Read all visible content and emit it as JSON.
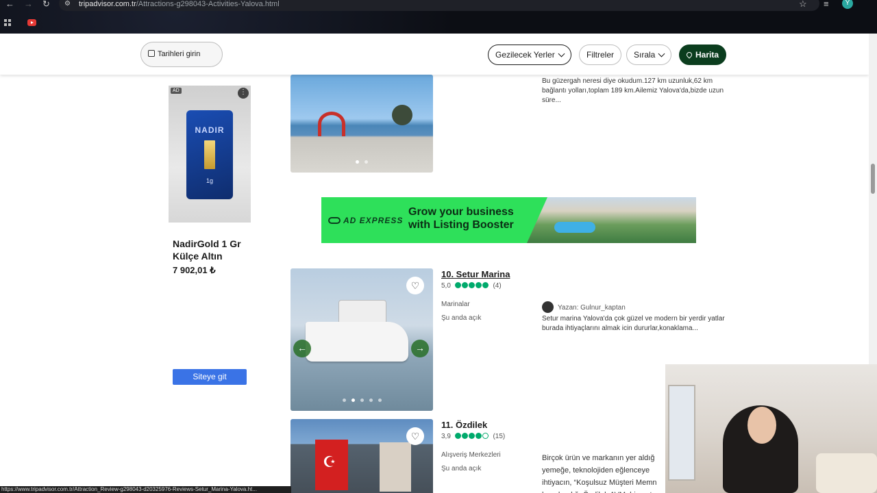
{
  "browser": {
    "url_domain": "tripadvisor.com.tr",
    "url_path": "/Attractions-g298043-Activities-Yalova.html",
    "profile_initial": "Y",
    "status_url": "https://www.tripadvisor.com.tr/Attraction_Review-g298043-d20325976-Reviews-Setur_Marina-Yalova.ht..."
  },
  "toolbar": {
    "dates_label": "Tarihleri girin",
    "category_label": "Gezilecek Yerler",
    "filters_label": "Filtreler",
    "sort_label": "Sırala",
    "map_label": "Harita"
  },
  "ad": {
    "tag": "AD",
    "product_brand": "NADIR",
    "product_weight": "1g",
    "title": "NadirGold 1 Gr Külçe Altın",
    "price": "7 902,01 ₺",
    "cta": "Siteye git"
  },
  "banner": {
    "brand": "AD EXPRESS",
    "headline_line1": "Grow your business",
    "headline_line2": "with Listing Booster"
  },
  "listings": [
    {
      "snippet": "Bu güzergah neresi diye okudum.127 km uzunluk,62 km bağlantı yolları,toplam 189 km.Ailemiz Yalova'da,bizde uzun süre..."
    },
    {
      "title": "10. Setur Marina",
      "rating_value": "5,0",
      "review_count": "(4)",
      "category": "Marinalar",
      "open_status": "Şu anda açık",
      "author": "Yazan: Gulnur_kaptan",
      "snippet": "Setur marina Yalova'da çok güzel ve modern bir yerdir yatlar burada ihtiyaçlarını almak icin dururlar,konaklama..."
    },
    {
      "title": "11. Özdilek",
      "rating_value": "3,9",
      "review_count": "(15)",
      "category": "Alışveriş Merkezleri",
      "open_status": "Şu anda açık",
      "snippet": "Birçok ürün ve markanın yer aldığ yemeğe, teknolojiden eğlenceye ihtiyacın, “Koşulsuz Müşteri Memn karşılandığı Özdilek AVM, hizmet"
    }
  ],
  "colors": {
    "accent_green": "#00aa6c",
    "map_button": "#0b3d1e",
    "banner_green": "#2ee05a",
    "cta_blue": "#3a73e6"
  }
}
